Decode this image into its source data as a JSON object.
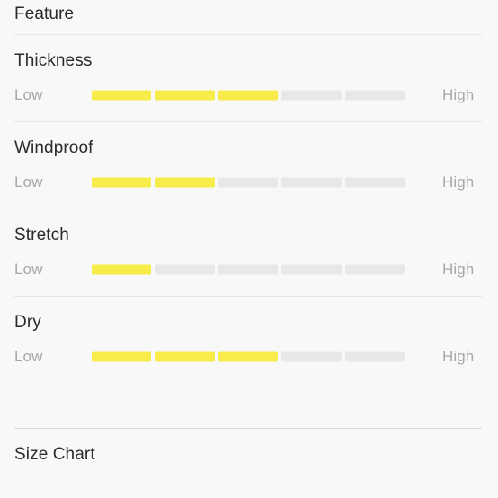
{
  "page": {
    "background_color": "#f8f8f8",
    "accent_color": "#f7ec4a",
    "track_color": "#e8e8e8",
    "divider_color": "#e6e6e6",
    "text_color": "#2a2a2a",
    "muted_text_color": "#a8a8a8"
  },
  "feature_section": {
    "title": "Feature",
    "scale_min_label": "Low",
    "scale_max_label": "High",
    "segments_total": 5,
    "rows": [
      {
        "label": "Thickness",
        "low": "Low",
        "high": "High",
        "filled": 3
      },
      {
        "label": "Windproof",
        "low": "Low",
        "high": "High",
        "filled": 2
      },
      {
        "label": "Stretch",
        "low": "Low",
        "high": "High",
        "filled": 1
      },
      {
        "label": "Dry",
        "low": "Low",
        "high": "High",
        "filled": 3
      }
    ]
  },
  "size_chart_section": {
    "title": "Size Chart"
  },
  "chart_data": {
    "type": "bar",
    "title": "Feature",
    "xlabel": "",
    "ylabel": "",
    "categories": [
      "Thickness",
      "Windproof",
      "Stretch",
      "Dry"
    ],
    "values": [
      3,
      2,
      1,
      3
    ],
    "ylim": [
      0,
      5
    ],
    "grid": false,
    "legend": "none",
    "tick_labels": [
      "Low",
      "High"
    ],
    "annotations": [
      "5-segment discrete rating bars; filled segments shown in yellow"
    ]
  }
}
